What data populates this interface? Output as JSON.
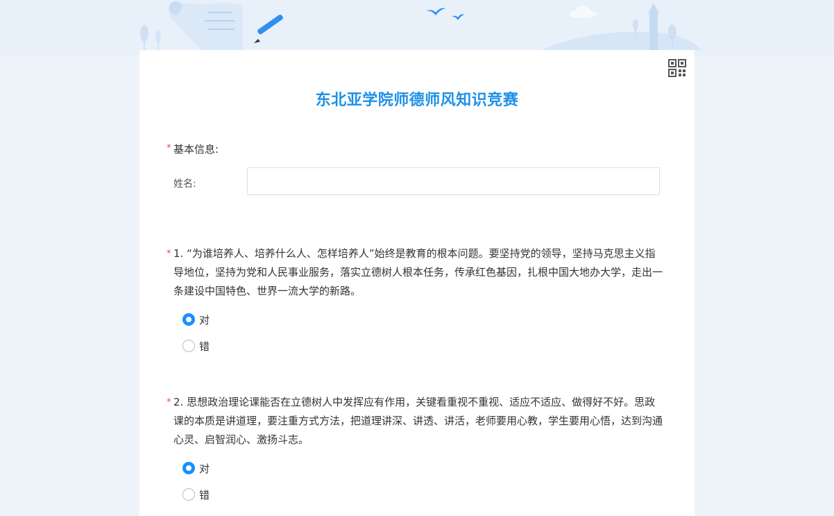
{
  "form": {
    "title": "东北亚学院师德师风知识竞赛"
  },
  "basic_info": {
    "label": "基本信息:",
    "name_label": "姓名:",
    "name_value": "",
    "name_placeholder": ""
  },
  "questions": [
    {
      "text": "1. “为谁培养人、培养什么人、怎样培养人”始终是教育的根本问题。要坚持党的领导，坚持马克思主义指导地位，坚持为党和人民事业服务，落实立德树人根本任务，传承红色基因，扎根中国大地办大学，走出一条建设中国特色、世界一流大学的新路。",
      "options": [
        "对",
        "错"
      ],
      "selected": "对"
    },
    {
      "text": "2. 思想政治理论课能否在立德树人中发挥应有作用，关键看重视不重视、适应不适应、做得好不好。思政课的本质是讲道理，要注重方式方法，把道理讲深、讲透、讲活，老师要用心教，学生要用心悟，达到沟通心灵、启智润心、激扬斗志。",
      "options": [
        "对",
        "错"
      ],
      "selected": "对"
    }
  ],
  "required_mark": "*",
  "colors": {
    "accent": "#1890ff",
    "title": "#1e90e6",
    "required": "#e84a4a",
    "background": "#eef3fa"
  },
  "icons": {
    "qr": "qr-code-icon"
  }
}
